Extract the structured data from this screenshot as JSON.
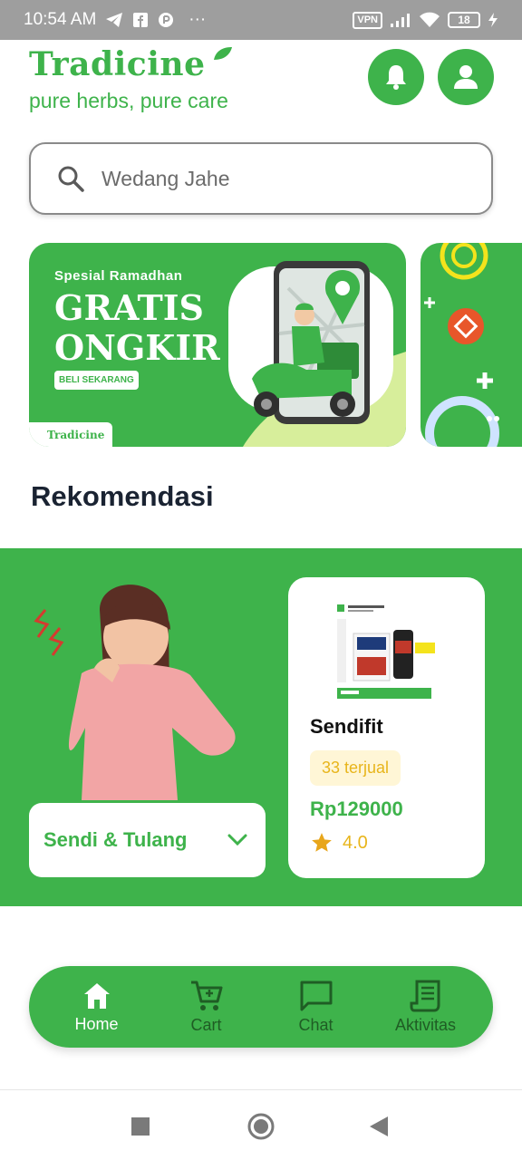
{
  "status_bar": {
    "time": "10:54 AM",
    "dots": "···",
    "vpn": "VPN",
    "battery": "18"
  },
  "header": {
    "brand": "Tradicine",
    "tagline": "pure herbs, pure care"
  },
  "search": {
    "value": "Wedang Jahe"
  },
  "banner": {
    "subtitle": "Spesial Ramadhan",
    "title_line1": "GRATIS",
    "title_line2": "ONGKIR",
    "cta": "BELI SEKARANG",
    "logo": "Tradicine"
  },
  "recommendation": {
    "title": "Rekomendasi",
    "category": "Sendi & Tulang",
    "product": {
      "name": "Sendifit",
      "sold": "33 terjual",
      "price": "Rp129000",
      "rating": "4.0",
      "rating_value": 4.0
    }
  },
  "bottom_nav": {
    "items": [
      {
        "label": "Home",
        "icon": "home-icon",
        "active": true
      },
      {
        "label": "Cart",
        "icon": "cart-icon",
        "active": false
      },
      {
        "label": "Chat",
        "icon": "chat-icon",
        "active": false
      },
      {
        "label": "Aktivitas",
        "icon": "receipt-icon",
        "active": false
      }
    ]
  },
  "colors": {
    "brand_green": "#3eb34b",
    "accent_yellow": "#e8b51b",
    "status_bar": "#9e9e9e"
  }
}
